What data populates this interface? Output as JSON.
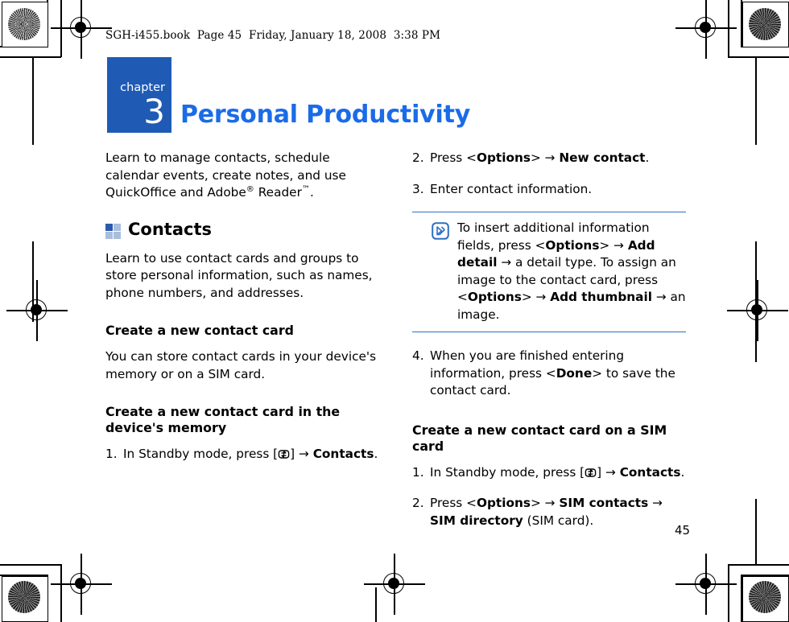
{
  "file_header": "SGH-i455.book  Page 45  Friday, January 18, 2008  3:38 PM",
  "chapter": {
    "word": "chapter",
    "number": "3",
    "title": "Personal Productivity",
    "badge_color": "#1F5BB5",
    "title_color": "#1A6BE8"
  },
  "intro": {
    "part1": "Learn to manage contacts, schedule calendar events, create notes, and use QuickOffice and Adobe",
    "sup1": "®",
    "part2": " Reader",
    "sup2": "™",
    "part3": "."
  },
  "contacts_section": {
    "heading": "Contacts",
    "icon": "grid-2x2-icon",
    "icon_colors": {
      "active": "#2A5CAA",
      "inactive": "#A8BEDC"
    },
    "intro": "Learn to use contact cards and groups to store personal information, such as names, phone numbers, and addresses."
  },
  "create_card": {
    "heading": "Create a new contact card",
    "body": "You can store contact cards in your device's memory or on a SIM card.",
    "device_memory_heading": "Create a new contact card in the device's memory",
    "steps": [
      {
        "num": "1.",
        "pre": "In Standby mode, press [",
        "icon": "menu-key-icon",
        "mid": "] ",
        "arrow": "→",
        "bold": "Contacts",
        "post": "."
      },
      {
        "num": "2.",
        "pre": "Press <",
        "bold1": "Options",
        "mid": "> ",
        "arrow": "→",
        "bold2": "New contact",
        "post": "."
      },
      {
        "num": "3.",
        "text": "Enter contact information."
      },
      {
        "num": "4.",
        "pre": "When you are finished entering information, press <",
        "bold1": "Done",
        "post": "> to save the contact card."
      }
    ]
  },
  "note": {
    "icon": "note-pencil-icon",
    "icon_color": "#2F6FC4",
    "seg1": "To insert additional information fields, press <",
    "b1": "Options",
    "seg2": "> ",
    "arrow1": "→",
    "b2": "Add detail",
    "seg3": " ",
    "arrow2": "→",
    "seg4": " a detail type. To assign an image to the contact card, press <",
    "b3": "Options",
    "seg5": "> ",
    "arrow3": "→",
    "b4": "Add thumbnail",
    "seg6": " ",
    "arrow4": "→",
    "seg7": " an image."
  },
  "sim_card": {
    "heading": "Create a new contact card on a SIM card",
    "steps": [
      {
        "num": "1.",
        "pre": "In Standby mode, press [",
        "icon": "menu-key-icon",
        "mid": "] ",
        "arrow": "→",
        "bold": "Contacts",
        "post": "."
      },
      {
        "num": "2.",
        "pre": "Press <",
        "bold1": "Options",
        "mid": "> ",
        "arrow1": "→",
        "bold2": "SIM contacts",
        "mid2": " ",
        "arrow2": "→",
        "bold3": "SIM directory",
        "post": " (SIM card)."
      }
    ]
  },
  "page_number": "45"
}
